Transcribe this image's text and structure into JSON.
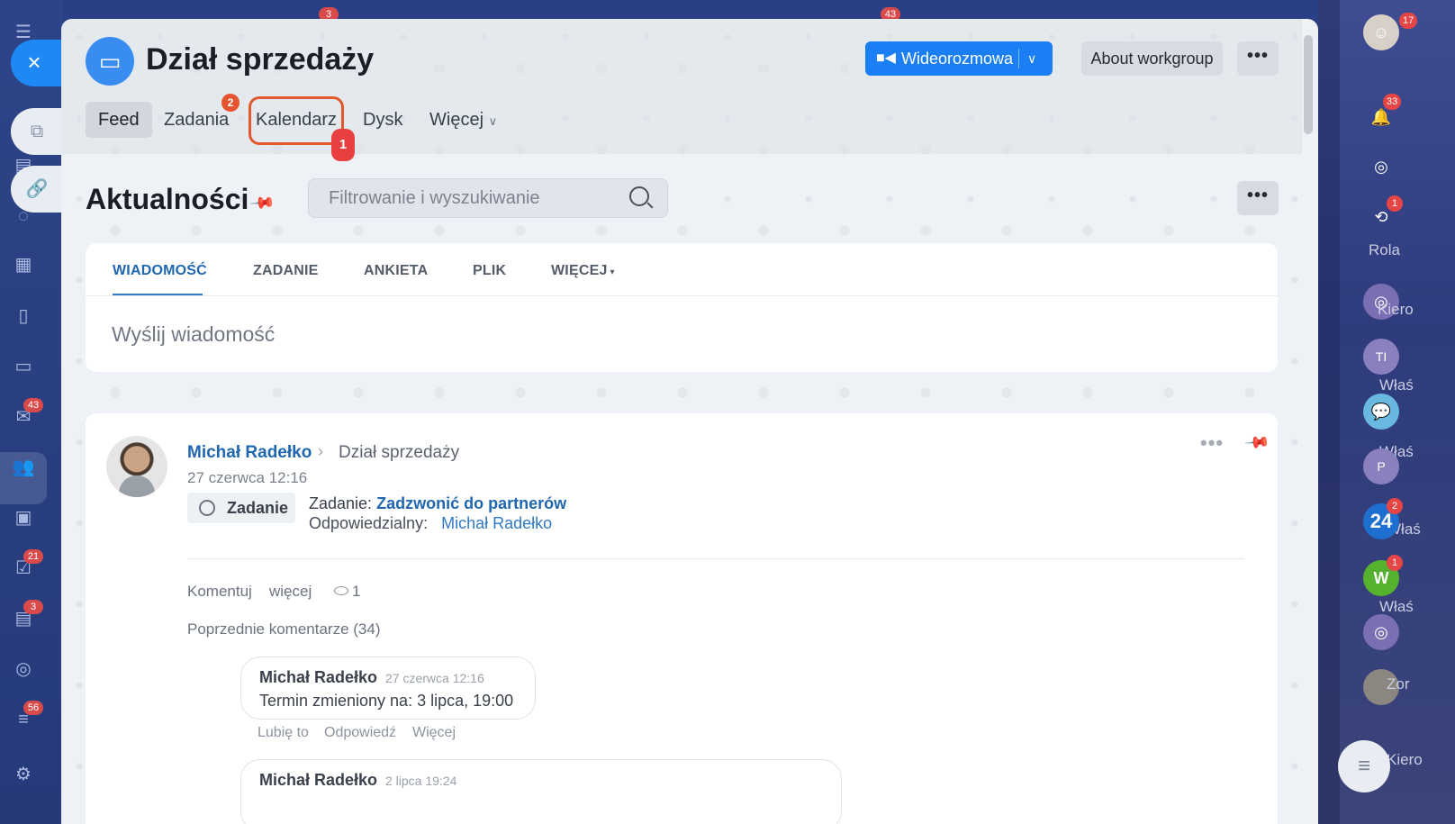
{
  "left_rail": {
    "badges": [
      "43",
      "21",
      "3",
      "56"
    ]
  },
  "top_bg": {
    "badges": [
      "3",
      "43"
    ]
  },
  "header": {
    "group_title": "Dział sprzedaży",
    "video_button": "Wideorozmowa",
    "about_button": "About workgroup"
  },
  "tabs": [
    {
      "label": "Feed"
    },
    {
      "label": "Zadania",
      "badge": "2"
    },
    {
      "label": "Kalendarz"
    },
    {
      "label": "Dysk"
    },
    {
      "label": "Więcej"
    }
  ],
  "step_marker": "1",
  "feed": {
    "title": "Aktualności",
    "filter_placeholder": "Filtrowanie i wyszukiwanie"
  },
  "composer": {
    "tabs": [
      "WIADOMOŚĆ",
      "ZADANIE",
      "ANKIETA",
      "PLIK",
      "WIĘCEJ"
    ],
    "placeholder": "Wyślij wiadomość"
  },
  "post": {
    "author": "Michał Radełko",
    "destination": "Dział sprzedaży",
    "date": "27 czerwca 12:16",
    "chip": "Zadanie",
    "task_prefix": "Zadanie:",
    "task_link": "Zadzwonić do partnerów",
    "responsible_label": "Odpowiedzialny:",
    "responsible_name": "Michał Radełko",
    "actions": {
      "comment": "Komentuj",
      "more": "więcej",
      "views": "1"
    },
    "previous_comments": "Poprzednie komentarze (34)"
  },
  "comments": [
    {
      "author": "Michał Radełko",
      "date": "27 czerwca 12:16",
      "text": "Termin zmieniony na: 3 lipca, 19:00",
      "actions": [
        "Lubię to",
        "Odpowiedź",
        "Więcej"
      ]
    },
    {
      "author": "Michał Radełko",
      "date": "2 lipca 19:24"
    }
  ],
  "right_rail": {
    "notif_badge": "33",
    "top_badge": "17",
    "items": [
      {
        "label": "Rola",
        "badge": "1"
      },
      {
        "label": "Kiero"
      },
      {
        "label": "Właś",
        "avatar": "TI"
      },
      {
        "label": "Właś"
      },
      {
        "label": "Właś",
        "avatar": "P"
      },
      {
        "label": "24",
        "badge": "2"
      },
      {
        "label": "Właś",
        "avatar": "W",
        "badge": "1"
      },
      {
        "label": "Zor"
      },
      {
        "label": "Kiero"
      }
    ]
  },
  "colors": {
    "accent": "#1a7ef5",
    "link": "#2067b0",
    "badge": "#e84040",
    "highlight": "#e15a2b"
  }
}
